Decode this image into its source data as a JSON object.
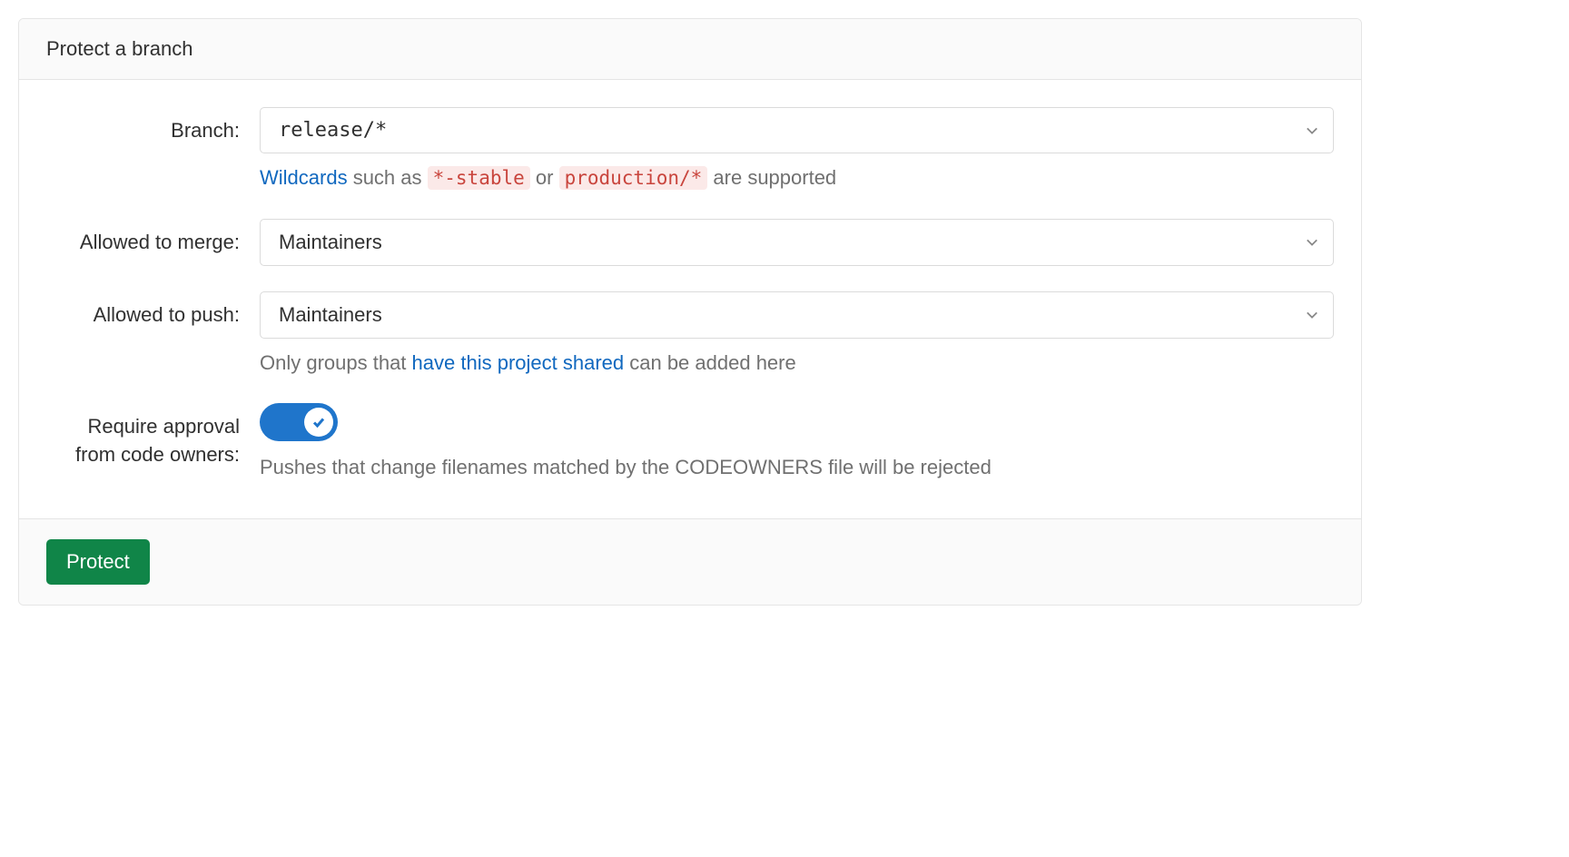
{
  "header": {
    "title": "Protect a branch"
  },
  "form": {
    "branch": {
      "label": "Branch:",
      "value": "release/*",
      "hint_prefix": "Wildcards",
      "hint_such_as": " such as ",
      "hint_chip1": "*-stable",
      "hint_or": " or ",
      "hint_chip2": "production/*",
      "hint_suffix": " are supported"
    },
    "merge": {
      "label": "Allowed to merge:",
      "value": "Maintainers"
    },
    "push": {
      "label": "Allowed to push:",
      "value": "Maintainers",
      "hint_prefix": "Only groups that ",
      "hint_link": "have this project shared",
      "hint_suffix": " can be added here"
    },
    "codeowners": {
      "label": "Require approval from code owners:",
      "enabled": true,
      "hint": "Pushes that change filenames matched by the CODEOWNERS file will be rejected"
    }
  },
  "footer": {
    "submit": "Protect"
  }
}
